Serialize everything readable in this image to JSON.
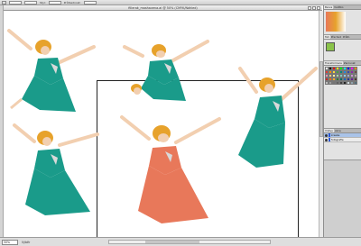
{
  "window": {
    "doc_title": "fillerak_mashavena.ai @ 50% (CMYK/Náhled)",
    "controls": [
      "",
      "",
      "",
      "",
      "Styl:",
      "Průhlednost:"
    ],
    "zoom": "50%",
    "status_label": "Výběr"
  },
  "panels": {
    "tabs_top": [
      "Barva",
      "Vodítko"
    ],
    "tabs_mid": [
      "Tah",
      "Přechod",
      "Průhl."
    ],
    "tabs_swatch": [
      "Transformace",
      "Zarovnat",
      "Lupa"
    ],
    "tabs_layers": [
      "Vrstvy",
      "Akce"
    ],
    "layers": [
      {
        "name": "kresba",
        "selected": true
      },
      {
        "name": "fotografie",
        "selected": false
      }
    ],
    "swatch_colors": [
      "#ffffff",
      "#000000",
      "#ff0000",
      "#ffff00",
      "#00ff00",
      "#00ffff",
      "#0000ff",
      "#ff00ff",
      "#ff8800",
      "#e53935",
      "#fb8c00",
      "#fdd835",
      "#43a047",
      "#00897b",
      "#1e88e5",
      "#3949ab",
      "#8e24aa",
      "#6d4c41",
      "#f48fb1",
      "#ffcc80",
      "#fff59d",
      "#a5d6a7",
      "#80cbc4",
      "#90caf9",
      "#9fa8da",
      "#ce93d8",
      "#bcaaa4",
      "#c62828",
      "#ef6c00",
      "#f9a825",
      "#2e7d32",
      "#00695c",
      "#1565c0",
      "#283593",
      "#6a1b9a",
      "#4e342e",
      "#bdbdbd",
      "#9e9e9e",
      "#757575",
      "#616161",
      "#424242",
      "#212121",
      "#cfd8dc",
      "#90a4ae",
      "#546e7a"
    ]
  },
  "figures": [
    {
      "id": "fig1",
      "dress": "#1a9b8a"
    },
    {
      "id": "fig2",
      "dress": "#1a9b8a"
    },
    {
      "id": "fig3",
      "dress": "#1a9b8a"
    },
    {
      "id": "fig4",
      "dress": "#1a9b8a"
    },
    {
      "id": "fig5",
      "dress": "#e8785a"
    }
  ],
  "colors": {
    "skin": "#f2cfb0",
    "hair": "#e7a22b",
    "teal": "#1a9b8a",
    "salmon": "#e8785a"
  }
}
